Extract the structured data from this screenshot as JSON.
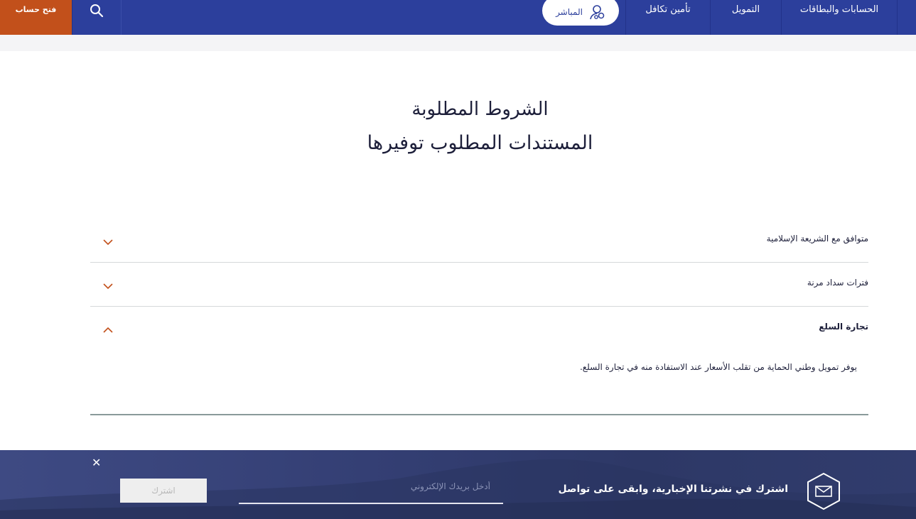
{
  "topnav": {
    "open_account": "فتح حساب",
    "items": [
      {
        "label": "الحسابات والبطاقات"
      },
      {
        "label": "التمويل"
      },
      {
        "label": "تأمين تكافل"
      }
    ],
    "live_label": "المباشر",
    "icons": {
      "search": "search-icon",
      "live": "chat-person-icon"
    }
  },
  "page": {
    "title": "الشروط المطلوبة",
    "subtitle": "المستندات المطلوب توفيرها"
  },
  "accordion": {
    "items": [
      {
        "title": "متوافق مع الشريعة الإسلامية",
        "expanded": false
      },
      {
        "title": "فترات سداد مرنة",
        "expanded": false
      },
      {
        "title": "تجارة السلع",
        "expanded": true,
        "body": "يوفر تمويل وطني الحماية من تقلب الأسعار عند الاستفادة منه في تجارة السلع."
      }
    ]
  },
  "newsletter": {
    "text": "اشترك في نشرتنا الإخبارية، وابقى على تواصل",
    "email_placeholder": "أدخل بريدك الإلكتروني",
    "subscribe_label": "اشترك",
    "close_glyph": "✕"
  },
  "colors": {
    "nav_blue": "#2c3f9c",
    "accent_orange": "#c2501b",
    "text_dark": "#1d1f3a"
  }
}
